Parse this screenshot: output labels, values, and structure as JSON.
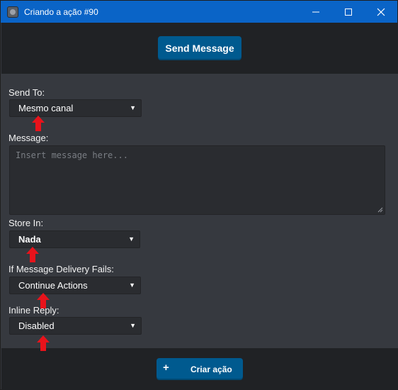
{
  "window": {
    "title": "Criando a ação #90"
  },
  "header": {
    "send_message_label": "Send Message"
  },
  "form": {
    "send_to": {
      "label": "Send To:",
      "value": "Mesmo canal"
    },
    "message": {
      "label": "Message:",
      "placeholder": "Insert message here..."
    },
    "store_in": {
      "label": "Store In:",
      "value": "Nada"
    },
    "delivery_fails": {
      "label": "If Message Delivery Fails:",
      "value": "Continue Actions"
    },
    "inline_reply": {
      "label": "Inline Reply:",
      "value": "Disabled"
    }
  },
  "footer": {
    "create_label": "Criar ação",
    "create_icon": "plus-icon"
  },
  "colors": {
    "titlebar": "#0a64c7",
    "primary_button": "#005a8f",
    "panel_dark": "#202225",
    "panel": "#36393f",
    "annotation_arrow": "#e8131b"
  }
}
